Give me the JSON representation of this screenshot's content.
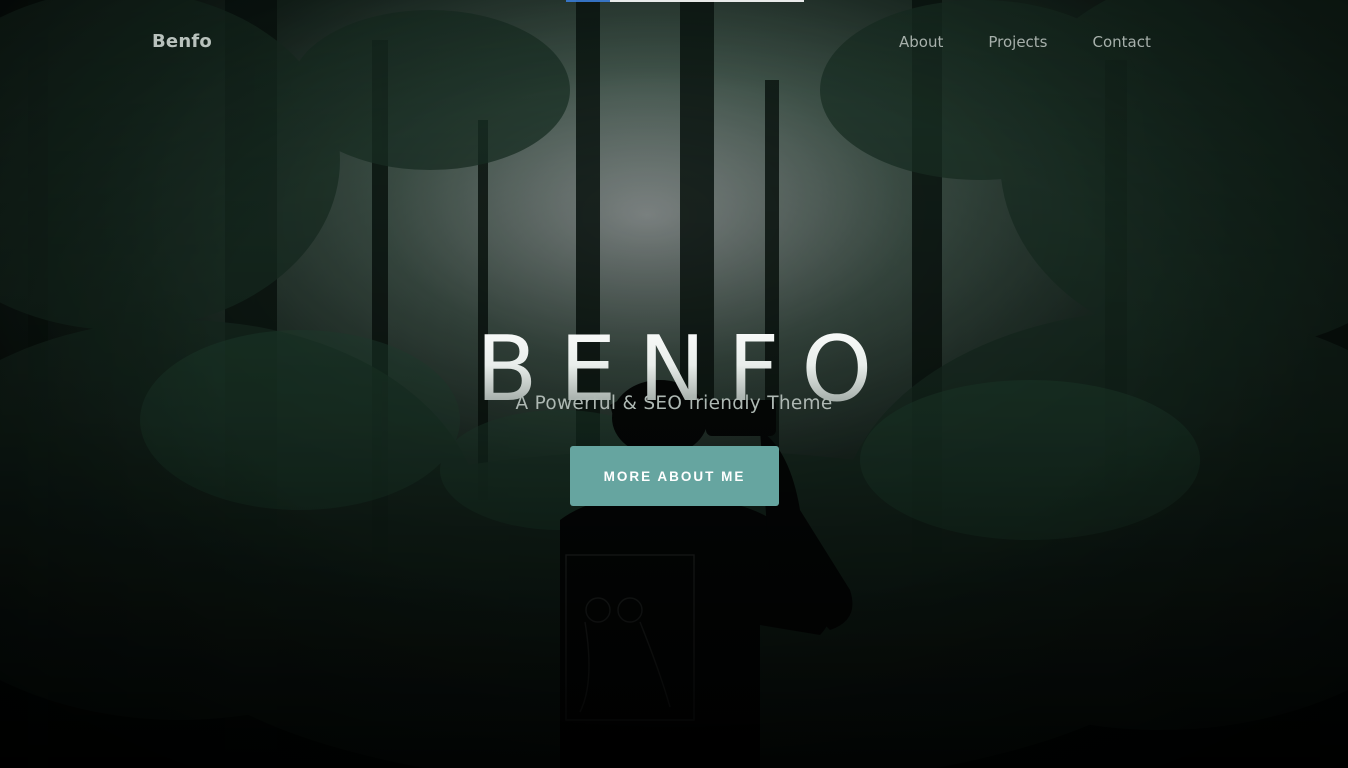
{
  "header": {
    "brand": "Benfo",
    "nav": [
      {
        "label": "About"
      },
      {
        "label": "Projects"
      },
      {
        "label": "Contact"
      }
    ]
  },
  "hero": {
    "title": "BENFO",
    "subtitle": "A Powerful & SEO friendly Theme",
    "cta_label": "MORE ABOUT ME"
  },
  "colors": {
    "accent": "#66a5a0",
    "overlay": "#0a130f"
  }
}
